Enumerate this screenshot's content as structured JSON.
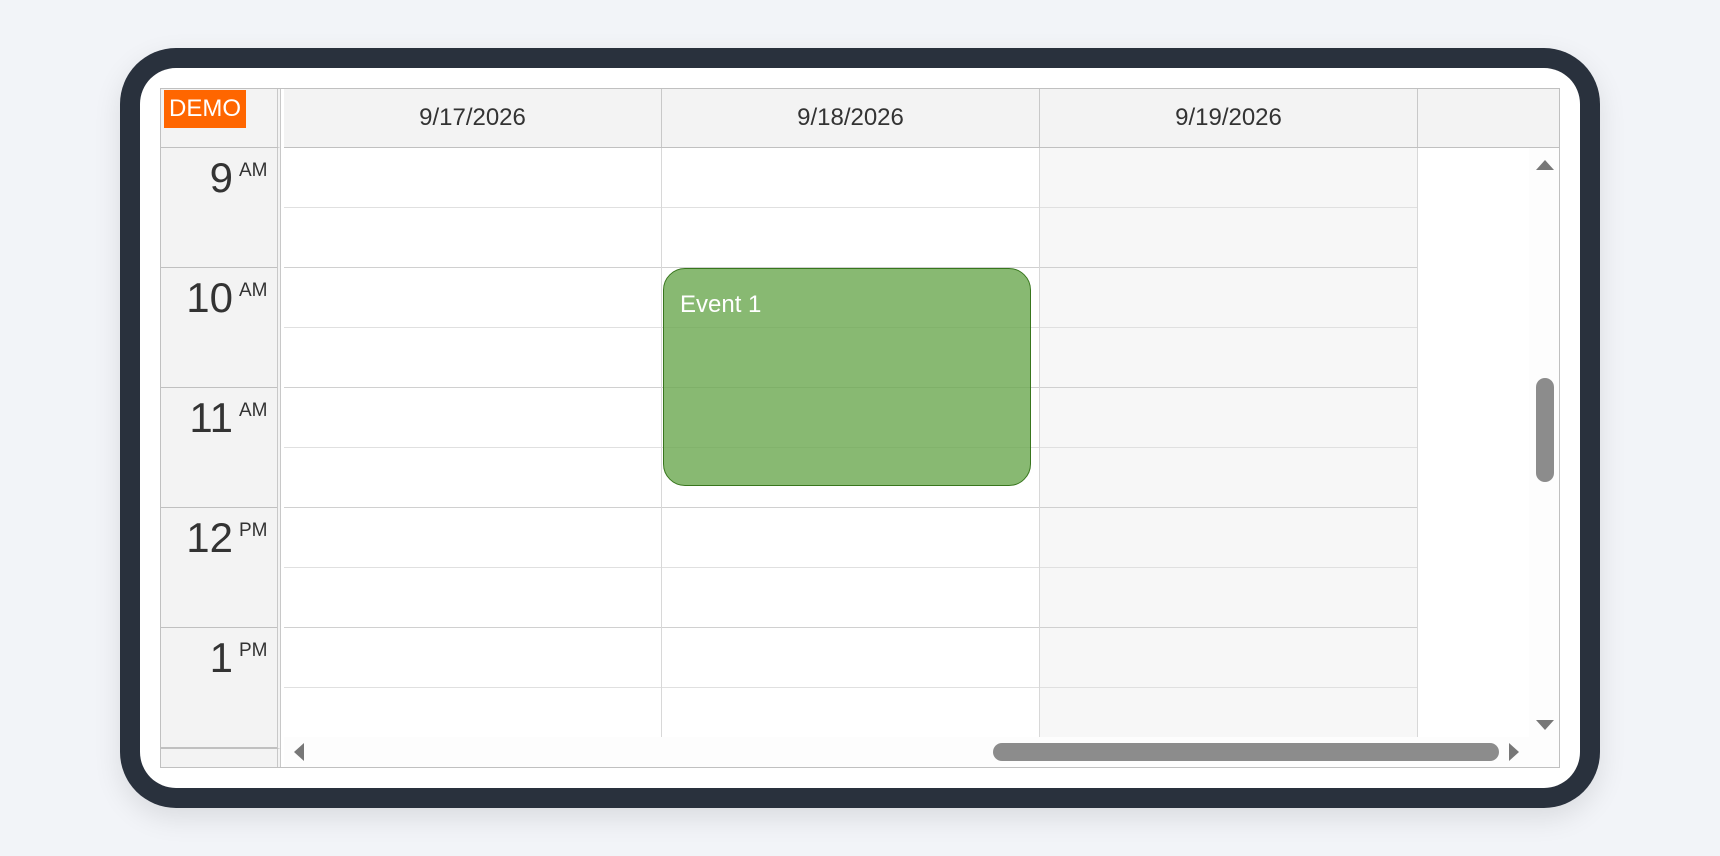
{
  "badge": {
    "label": "DEMO"
  },
  "columns": [
    {
      "date": "9/17/2026",
      "weekend": false
    },
    {
      "date": "9/18/2026",
      "weekend": false
    },
    {
      "date": "9/19/2026",
      "weekend": true
    }
  ],
  "hours": [
    {
      "num": "9",
      "ampm": "AM"
    },
    {
      "num": "10",
      "ampm": "AM"
    },
    {
      "num": "11",
      "ampm": "AM"
    },
    {
      "num": "12",
      "ampm": "PM"
    },
    {
      "num": "1",
      "ampm": "PM"
    }
  ],
  "events": [
    {
      "title": "Event 1",
      "date": "9/18/2026",
      "start": "10:00 AM",
      "end": "12:00 PM",
      "color": "#6aa84f",
      "border_color": "#38761d"
    }
  ],
  "colors": {
    "demo_badge": "#ff6600",
    "header_bg": "#f3f3f3",
    "weekend_bg": "#f7f7f7",
    "device_frame": "#29313d"
  }
}
